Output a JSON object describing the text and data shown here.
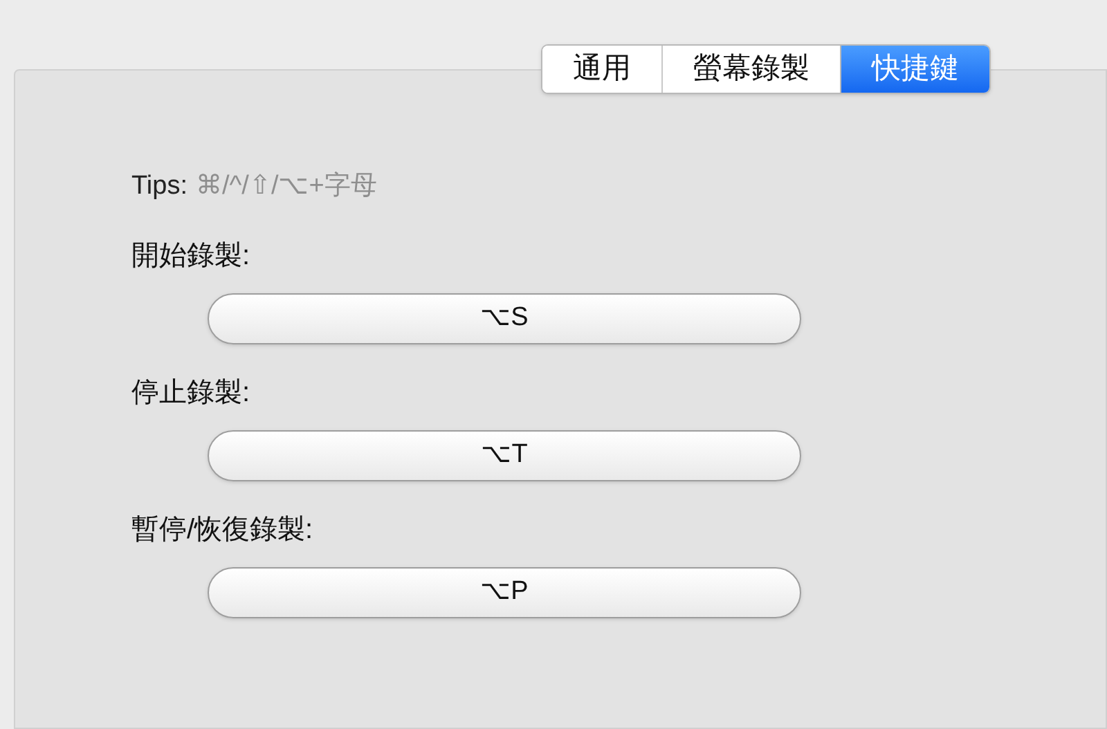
{
  "tabs": [
    {
      "label": "通用",
      "selected": false
    },
    {
      "label": "螢幕錄製",
      "selected": false
    },
    {
      "label": "快捷鍵",
      "selected": true
    }
  ],
  "tips": {
    "label": "Tips:",
    "value": "⌘/^/⇧/⌥+字母"
  },
  "shortcuts": [
    {
      "label": "開始錄製:",
      "value": "⌥S"
    },
    {
      "label": "停止錄製:",
      "value": "⌥T"
    },
    {
      "label": "暫停/恢復錄製:",
      "value": "⌥P"
    }
  ]
}
